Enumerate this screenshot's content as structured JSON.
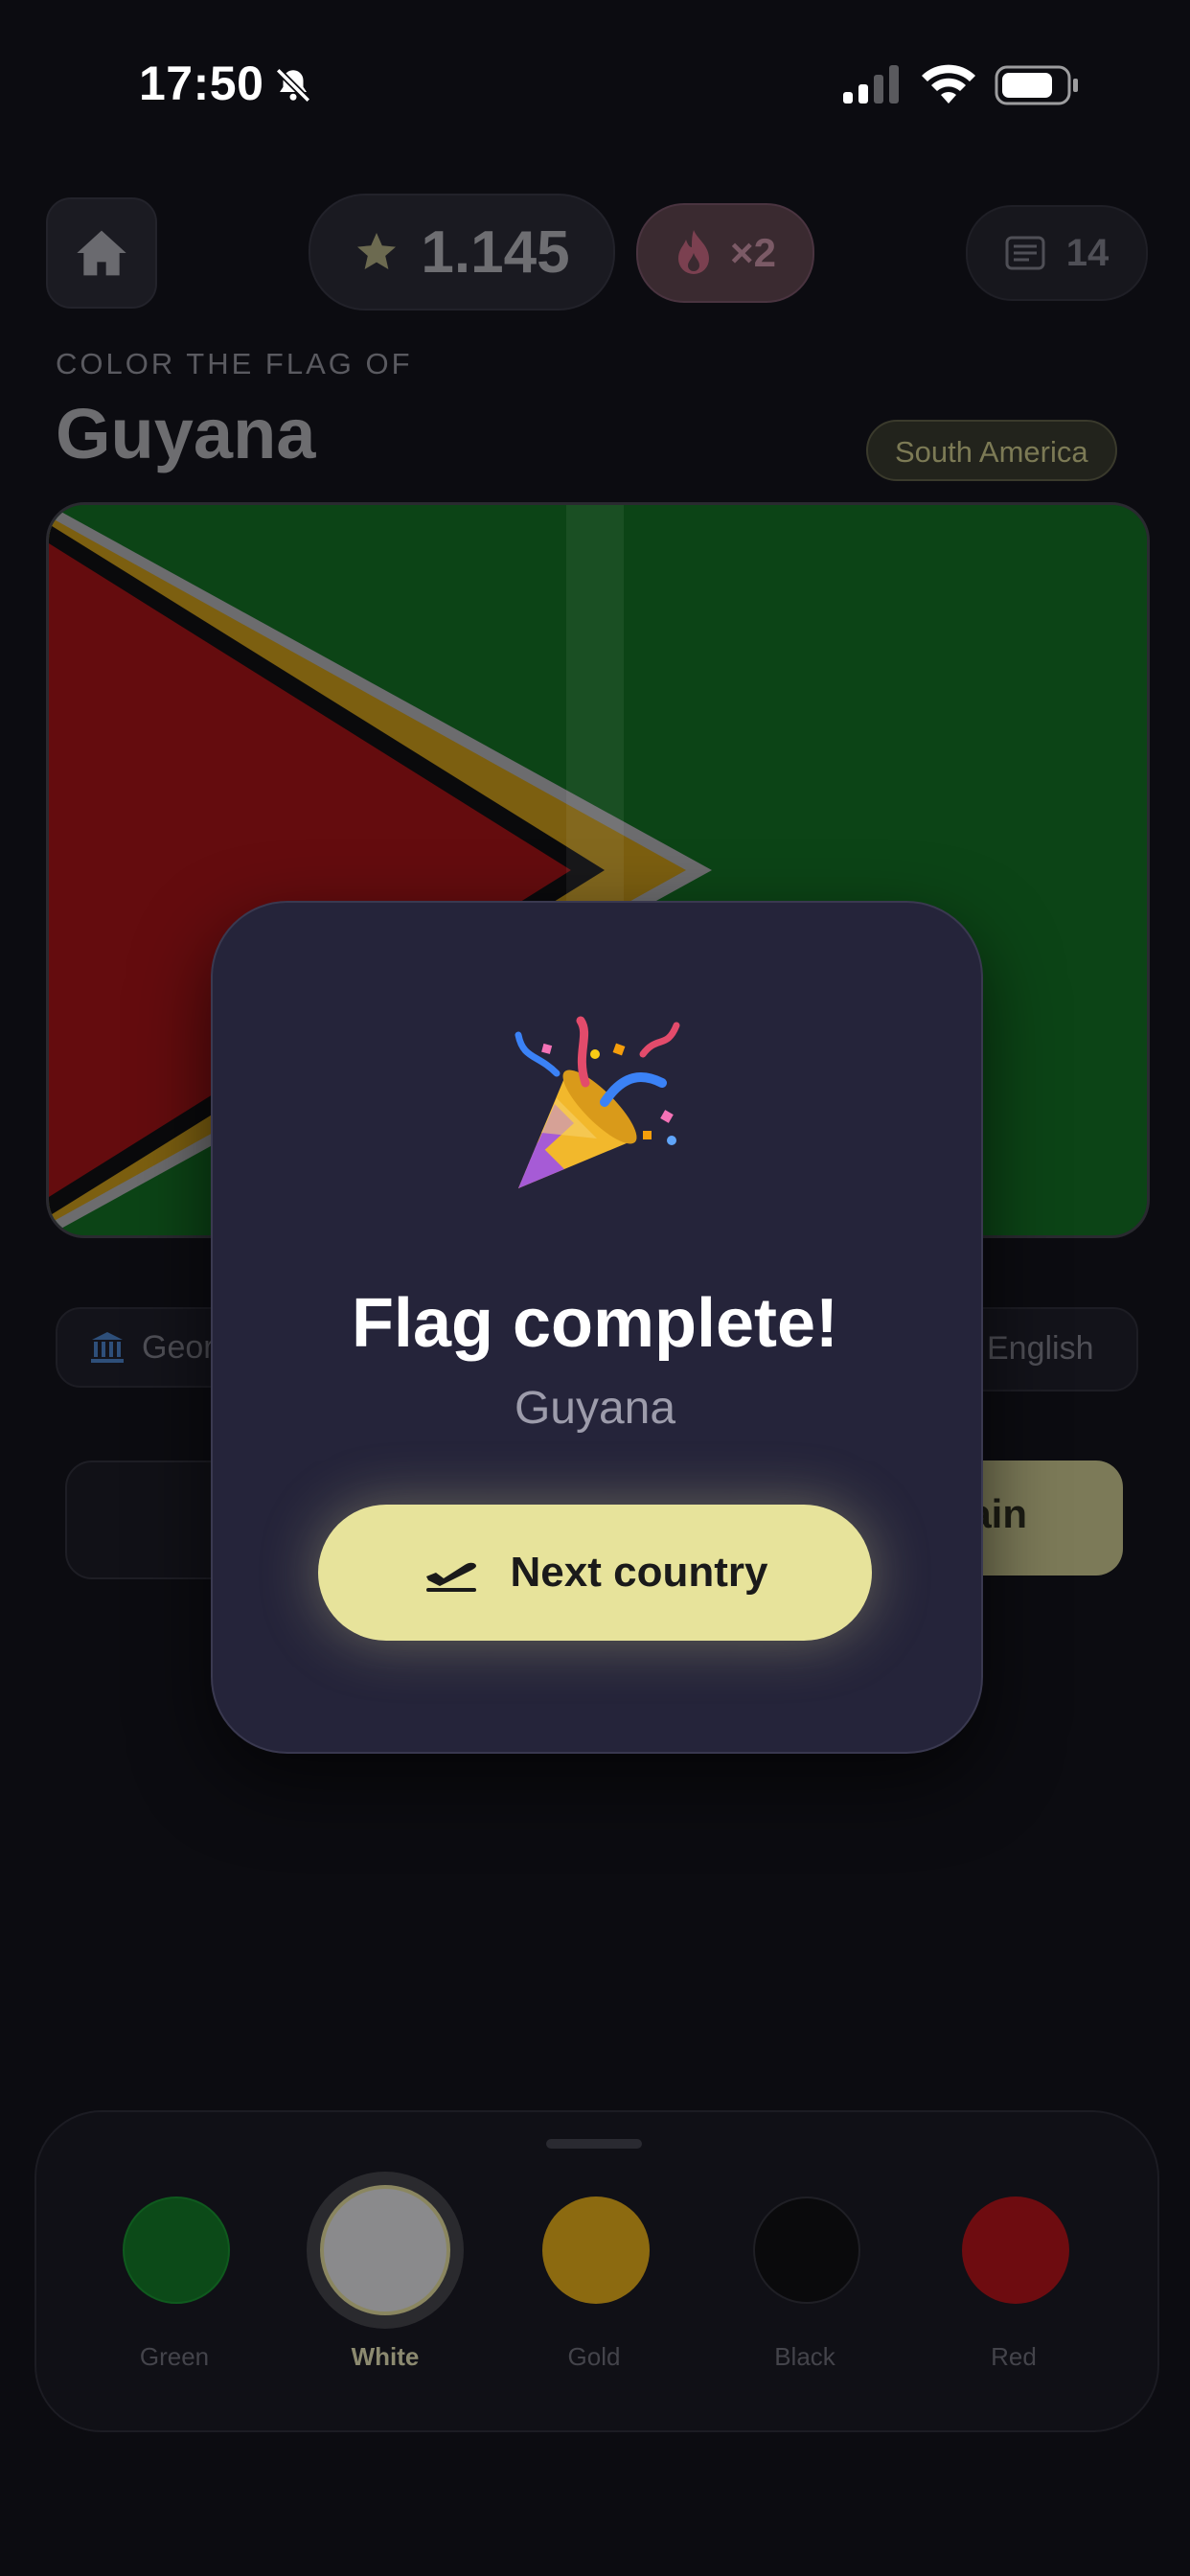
{
  "status_bar": {
    "time": "17:50"
  },
  "header": {
    "score": "1.145",
    "streak": "×2",
    "list_count": "14"
  },
  "prompt": {
    "subtitle": "COLOR THE FLAG OF",
    "country": "Guyana",
    "region": "South America"
  },
  "info_chips": {
    "capital_partial": "Geor",
    "language": "English"
  },
  "actions": {
    "right_button_partial": "ain"
  },
  "palette": {
    "colors": [
      {
        "label": "Green",
        "hex": "#0c4a18"
      },
      {
        "label": "White",
        "hex": "#8a8a8c",
        "selected": true
      },
      {
        "label": "Gold",
        "hex": "#8c6a10"
      },
      {
        "label": "Black",
        "hex": "#0a0a0c"
      },
      {
        "label": "Red",
        "hex": "#6e0c10"
      }
    ]
  },
  "modal": {
    "emoji": "🎉",
    "title": "Flag complete!",
    "country": "Guyana",
    "next_label": "Next country"
  },
  "accent_colors": {
    "next_button": "#e7e39b",
    "modal_bg": "#25243a"
  }
}
